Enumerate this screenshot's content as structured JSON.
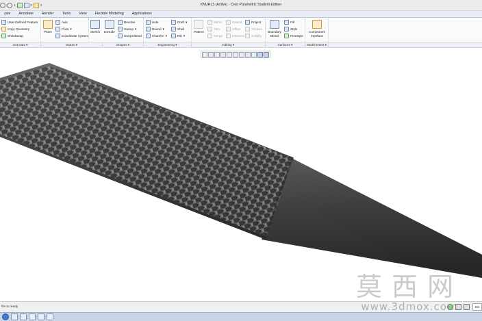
{
  "window": {
    "title": "KNURL3 (Active) - Creo Parametric Student Edition"
  },
  "ribbon_tabs": [
    {
      "label": "ysis"
    },
    {
      "label": "Annotate"
    },
    {
      "label": "Render"
    },
    {
      "label": "Tools"
    },
    {
      "label": "View"
    },
    {
      "label": "Flexible Modeling"
    },
    {
      "label": "Applications"
    }
  ],
  "ribbon": {
    "get_data": {
      "user_defined_feature": "User-Defined Feature",
      "copy_geometry": "Copy Geometry",
      "shrinkwrap": "Shrinkwrap"
    },
    "datum": {
      "plane": "Plane",
      "axis": "Axis",
      "point": "Point",
      "coordinate_system": "Coordinate System"
    },
    "shapes": {
      "sketch": "Sketch",
      "extrude": "Extrude",
      "revolve": "Revolve",
      "sweep": "Sweep",
      "swept_blend": "Swept Blend"
    },
    "engineering": {
      "hole": "Hole",
      "round": "Round",
      "chamfer": "Chamfer",
      "draft": "Draft",
      "shell": "Shell",
      "rib": "Rib"
    },
    "editing": {
      "pattern": "Pattern",
      "mirror": "Mirror",
      "trim": "Trim",
      "merge": "Merge",
      "extend": "Extend",
      "offset": "Offset",
      "intersect": "Intersect",
      "project": "Project",
      "thicken": "Thicken",
      "solidify": "Solidify"
    },
    "surfaces": {
      "boundary_blend": "Boundary Blend",
      "fill": "Fill",
      "style": "Style",
      "freestyle": "Freestyle"
    },
    "model_intent": {
      "component_interface": "Component Interface"
    }
  },
  "group_labels": {
    "get_data": "Get Data ▾",
    "datum": "Datum ▾",
    "shapes": "Shapes ▾",
    "engineering": "Engineering ▾",
    "editing": "Editing ▾",
    "surfaces": "Surfaces ▾",
    "model_intent": "Model Intent ▾"
  },
  "status": {
    "message": "file is ready",
    "filter": "Sm"
  },
  "watermark": {
    "chinese": "莫西网",
    "url": "www.3dmox.com"
  },
  "colors": {
    "ribbon_bg": "#fbfbfb",
    "tab_bar": "#e9eef6",
    "model_dark": "#3a3a3a",
    "model_light": "#6a6a6a"
  }
}
